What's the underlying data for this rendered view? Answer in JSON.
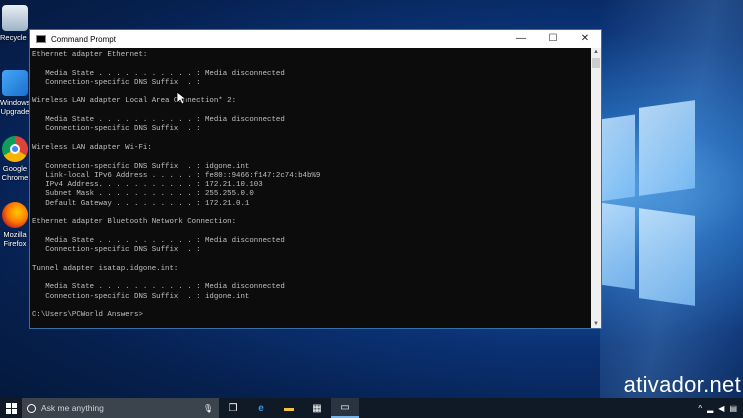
{
  "desktop": {
    "icons": [
      {
        "label": "Recycle B",
        "icon": "recycle-bin-icon"
      },
      {
        "label": "Windows",
        "label2": "Upgrade",
        "icon": "windows-upgrade-icon"
      },
      {
        "label": "Google",
        "label2": "Chrome",
        "icon": "chrome-icon"
      },
      {
        "label": "Mozilla",
        "label2": "Firefox",
        "icon": "firefox-icon"
      }
    ]
  },
  "window": {
    "title": "Command Prompt",
    "minimize": "—",
    "maximize": "☐",
    "close": "✕"
  },
  "console": {
    "lines": [
      "Ethernet adapter Ethernet:",
      "",
      "   Media State . . . . . . . . . . . : Media disconnected",
      "   Connection-specific DNS Suffix  . :",
      "",
      "Wireless LAN adapter Local Area Connection* 2:",
      "",
      "   Media State . . . . . . . . . . . : Media disconnected",
      "   Connection-specific DNS Suffix  . :",
      "",
      "Wireless LAN adapter Wi-Fi:",
      "",
      "   Connection-specific DNS Suffix  . : idgone.int",
      "   Link-local IPv6 Address . . . . . : fe80::9466:f147:2c74:b4b%9",
      "   IPv4 Address. . . . . . . . . . . : 172.21.10.103",
      "   Subnet Mask . . . . . . . . . . . : 255.255.0.0",
      "   Default Gateway . . . . . . . . . : 172.21.0.1",
      "",
      "Ethernet adapter Bluetooth Network Connection:",
      "",
      "   Media State . . . . . . . . . . . : Media disconnected",
      "   Connection-specific DNS Suffix  . :",
      "",
      "Tunnel adapter isatap.idgone.int:",
      "",
      "   Media State . . . . . . . . . . . : Media disconnected",
      "   Connection-specific DNS Suffix  . : idgone.int",
      "",
      "C:\\Users\\PCWorld Answers>"
    ]
  },
  "watermark": "ativador.net",
  "taskbar": {
    "search_placeholder": "Ask me anything",
    "buttons": [
      {
        "name": "task-view-icon",
        "glyph": "❐"
      },
      {
        "name": "edge-icon",
        "glyph": "e"
      },
      {
        "name": "file-explorer-icon",
        "glyph": "▬"
      },
      {
        "name": "store-icon",
        "glyph": "▦"
      },
      {
        "name": "command-prompt-taskbar-icon",
        "glyph": "▭"
      }
    ],
    "tray": [
      {
        "name": "show-hidden-icons-icon",
        "glyph": "^"
      },
      {
        "name": "network-icon",
        "glyph": "▂"
      },
      {
        "name": "volume-icon",
        "glyph": "◀"
      },
      {
        "name": "notification-icon",
        "glyph": "▤"
      }
    ]
  },
  "colors": {
    "console_bg": "#0c0c0c",
    "console_fg": "#c0c0c0",
    "taskbar_bg": "#101a26",
    "search_bg": "#3b434c"
  }
}
